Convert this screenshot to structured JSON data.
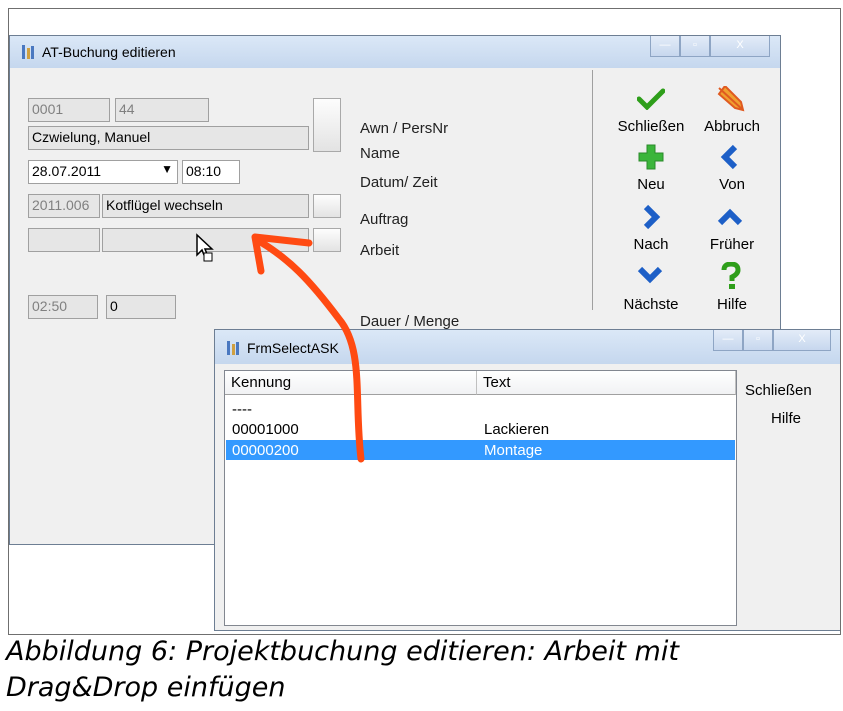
{
  "main_window": {
    "title": "AT-Buchung editieren",
    "controls": {
      "minimize": "—",
      "maximize": "▫",
      "close": "X"
    },
    "fields": {
      "awn": "0001",
      "persnr": "44",
      "name": "Czwielung, Manuel",
      "date": "28.07.2011",
      "time": "08:10",
      "order_nr": "2011.006",
      "order_text": "Kotflügel wechseln",
      "work_nr": "",
      "work_text": "",
      "duration": "02:50",
      "quantity": "0"
    },
    "labels": {
      "awn_persnr": "Awn / PersNr",
      "name": "Name",
      "date_time": "Datum/ Zeit",
      "order": "Auftrag",
      "work": "Arbeit",
      "duration_qty": "Dauer / Menge"
    },
    "toolbar": [
      {
        "label": "Schließen",
        "icon": "check-icon",
        "color": "#2e9e1a"
      },
      {
        "label": "Abbruch",
        "icon": "abort-icon",
        "color": "#e8762a"
      },
      {
        "label": "Neu",
        "icon": "plus-icon",
        "color": "#3bb53b"
      },
      {
        "label": "Von",
        "icon": "chevron-left-icon",
        "color": "#1d5fc7"
      },
      {
        "label": "Nach",
        "icon": "chevron-right-icon",
        "color": "#1d5fc7"
      },
      {
        "label": "Früher",
        "icon": "chevron-up-icon",
        "color": "#1d5fc7"
      },
      {
        "label": "Nächste",
        "icon": "chevron-down-icon",
        "color": "#1d5fc7"
      },
      {
        "label": "Hilfe",
        "icon": "question-icon",
        "color": "#2e9e1a"
      }
    ]
  },
  "select_window": {
    "title": "FrmSelectASK",
    "controls": {
      "minimize": "—",
      "maximize": "▫",
      "close": "X"
    },
    "columns": [
      "Kennung",
      "Text"
    ],
    "rows": [
      {
        "kennung": "----",
        "text": "",
        "selected": false
      },
      {
        "kennung": "00001000",
        "text": "Lackieren",
        "selected": false
      },
      {
        "kennung": "00000200",
        "text": "Montage",
        "selected": true
      }
    ],
    "side_buttons": {
      "close": "Schließen",
      "help": "Hilfe"
    }
  },
  "annotation": {
    "arrow_color": "#ff4a12"
  },
  "caption": {
    "line1": "Abbildung 6: Projektbuchung editieren: Arbeit mit",
    "line2": "Drag&Drop einfügen"
  }
}
